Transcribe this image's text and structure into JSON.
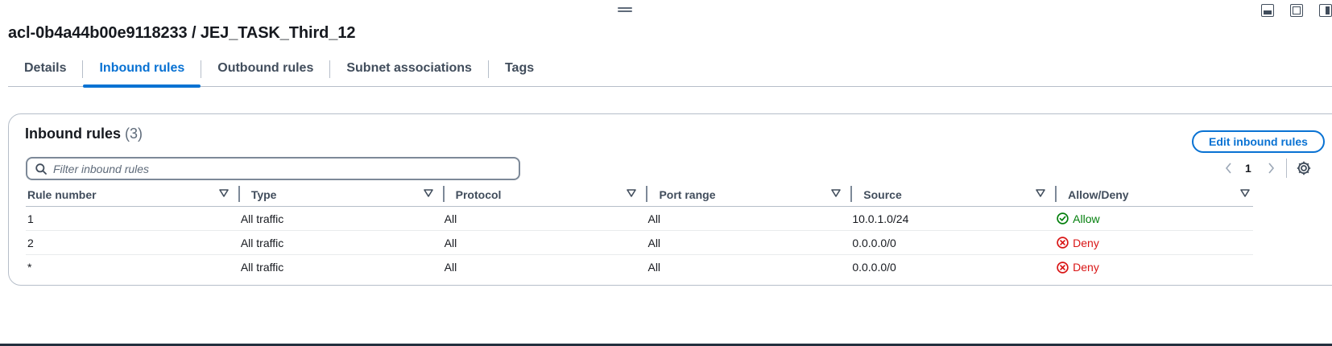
{
  "page": {
    "title": "acl-0b4a44b00e9118233 / JEJ_TASK_Third_12"
  },
  "tabs": [
    {
      "label": "Details",
      "active": false
    },
    {
      "label": "Inbound rules",
      "active": true
    },
    {
      "label": "Outbound rules",
      "active": false
    },
    {
      "label": "Subnet associations",
      "active": false
    },
    {
      "label": "Tags",
      "active": false
    }
  ],
  "panel": {
    "heading": "Inbound rules",
    "count": "(3)",
    "edit_button": "Edit inbound rules",
    "filter_placeholder": "Filter inbound rules",
    "page_number": "1"
  },
  "table": {
    "columns": [
      "Rule number",
      "Type",
      "Protocol",
      "Port range",
      "Source",
      "Allow/Deny"
    ],
    "rows": [
      {
        "rule_number": "1",
        "type": "All traffic",
        "protocol": "All",
        "port_range": "All",
        "source": "10.0.1.0/24",
        "action": "Allow"
      },
      {
        "rule_number": "2",
        "type": "All traffic",
        "protocol": "All",
        "port_range": "All",
        "source": "0.0.0.0/0",
        "action": "Deny"
      },
      {
        "rule_number": "*",
        "type": "All traffic",
        "protocol": "All",
        "port_range": "All",
        "source": "0.0.0.0/0",
        "action": "Deny"
      }
    ]
  },
  "colors": {
    "accent": "#0972d3",
    "allow": "#037f0c",
    "deny": "#d91515"
  }
}
